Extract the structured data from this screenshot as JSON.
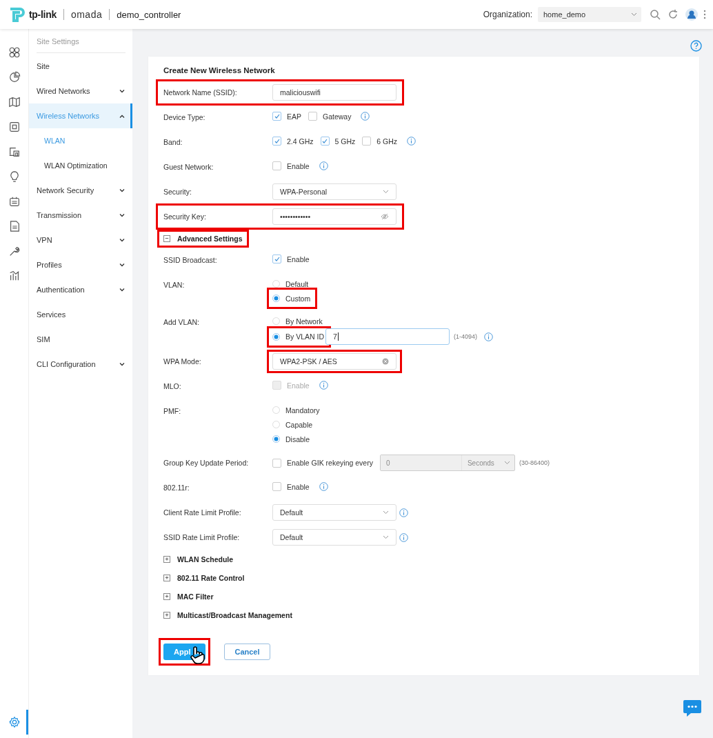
{
  "header": {
    "brand": "tp-link",
    "product": "omada",
    "controller": "demo_controller",
    "org_label": "Organization:",
    "org_value": "home_demo"
  },
  "rail": [
    {
      "selected": false
    },
    {
      "selected": false
    },
    {
      "selected": false
    },
    {
      "selected": false
    },
    {
      "selected": false
    },
    {
      "selected": false
    },
    {
      "selected": false
    },
    {
      "selected": false
    },
    {
      "selected": false
    },
    {
      "selected": false
    }
  ],
  "rail_bottom": {
    "selected": true
  },
  "sidebar": {
    "title": "Site Settings",
    "items": [
      {
        "label": "Site",
        "selected": false
      },
      {
        "label": "Wired Networks",
        "selected": false,
        "expanded": false
      },
      {
        "label": "Wireless Networks",
        "selected": true,
        "expanded": true,
        "children": [
          {
            "label": "WLAN",
            "selected": true
          },
          {
            "label": "WLAN Optimization",
            "selected": false
          }
        ]
      },
      {
        "label": "Network Security",
        "selected": false,
        "expanded": false
      },
      {
        "label": "Transmission",
        "selected": false,
        "expanded": false
      },
      {
        "label": "VPN",
        "selected": false,
        "expanded": false
      },
      {
        "label": "Profiles",
        "selected": false,
        "expanded": false
      },
      {
        "label": "Authentication",
        "selected": false,
        "expanded": false
      },
      {
        "label": "Services",
        "selected": false
      },
      {
        "label": "SIM",
        "selected": false
      },
      {
        "label": "CLI Configuration",
        "selected": false,
        "expanded": false
      }
    ]
  },
  "form": {
    "title": "Create New Wireless Network",
    "rows": [
      {
        "kind": "row",
        "label": "Network Name (SSID):",
        "highlighted": true,
        "lines": [
          [
            {
              "kind": "text",
              "value": "maliciouswifi"
            }
          ]
        ]
      },
      {
        "kind": "row",
        "label": "Device Type:",
        "lines": [
          [
            {
              "kind": "checkbox",
              "label": "EAP",
              "checked": true
            },
            {
              "kind": "checkbox",
              "label": "Gateway",
              "checked": false
            },
            {
              "kind": "info"
            }
          ]
        ]
      },
      {
        "kind": "row",
        "label": "Band:",
        "lines": [
          [
            {
              "kind": "checkbox",
              "label": "2.4 GHz",
              "checked": true
            },
            {
              "kind": "checkbox",
              "label": "5 GHz",
              "checked": true
            },
            {
              "kind": "checkbox",
              "label": "6 GHz",
              "checked": false
            },
            {
              "kind": "info"
            }
          ]
        ]
      },
      {
        "kind": "row",
        "label": "Guest Network:",
        "lines": [
          [
            {
              "kind": "checkbox",
              "label": "Enable",
              "checked": false
            },
            {
              "kind": "info"
            }
          ]
        ]
      },
      {
        "kind": "row",
        "label": "Security:",
        "lines": [
          [
            {
              "kind": "select",
              "value": "WPA-Personal"
            }
          ]
        ]
      },
      {
        "kind": "row",
        "label": "Security Key:",
        "highlighted": true,
        "lines": [
          [
            {
              "kind": "password",
              "value": "••••••••••••"
            }
          ]
        ]
      },
      {
        "kind": "section",
        "label": "Advanced Settings",
        "expanded": true,
        "highlighted": true
      },
      {
        "kind": "row",
        "label": "SSID Broadcast:",
        "lines": [
          [
            {
              "kind": "checkbox",
              "label": "Enable",
              "checked": true
            }
          ]
        ]
      },
      {
        "kind": "row",
        "label": "VLAN:",
        "lines": [
          [
            {
              "kind": "radio",
              "label": "Default",
              "selected": false
            }
          ],
          [
            {
              "kind": "radio",
              "label": "Custom",
              "selected": true,
              "highlighted": true
            }
          ]
        ]
      },
      {
        "kind": "row",
        "label": "Add VLAN:",
        "lines": [
          [
            {
              "kind": "radio",
              "label": "By Network",
              "selected": false
            }
          ],
          [
            {
              "kind": "radio",
              "label": "By VLAN ID",
              "selected": true,
              "highlighted": true
            },
            {
              "kind": "text",
              "value": "7",
              "focused": true
            },
            {
              "kind": "hint",
              "text": "(1-4094)"
            },
            {
              "kind": "info"
            }
          ]
        ]
      },
      {
        "kind": "row",
        "label": "WPA Mode:",
        "lines": [
          [
            {
              "kind": "select-clear",
              "value": "WPA2-PSK / AES",
              "highlighted": true
            }
          ]
        ]
      },
      {
        "kind": "row",
        "label": "MLO:",
        "lines": [
          [
            {
              "kind": "checkbox",
              "label": "Enable",
              "checked": false,
              "disabled": true
            },
            {
              "kind": "info"
            }
          ]
        ]
      },
      {
        "kind": "row",
        "label": "PMF:",
        "lines": [
          [
            {
              "kind": "radio",
              "label": "Mandatory",
              "selected": false
            }
          ],
          [
            {
              "kind": "radio",
              "label": "Capable",
              "selected": false
            }
          ],
          [
            {
              "kind": "radio",
              "label": "Disable",
              "selected": true
            }
          ]
        ]
      },
      {
        "kind": "row",
        "label": "Group Key Update Period:",
        "lines": [
          [
            {
              "kind": "checkbox",
              "label": "Enable GIK rekeying every",
              "checked": false
            },
            {
              "kind": "number-unit",
              "value": "0",
              "unit": "Seconds",
              "disabled": true
            },
            {
              "kind": "hint",
              "text": "(30-86400)"
            }
          ]
        ]
      },
      {
        "kind": "row",
        "label": "802.11r:",
        "lines": [
          [
            {
              "kind": "checkbox",
              "label": "Enable",
              "checked": false
            },
            {
              "kind": "info"
            }
          ]
        ]
      },
      {
        "kind": "row",
        "label": "Client Rate Limit Profile:",
        "lines": [
          [
            {
              "kind": "select",
              "value": "Default"
            },
            {
              "kind": "info"
            }
          ]
        ]
      },
      {
        "kind": "row",
        "label": "SSID Rate Limit Profile:",
        "lines": [
          [
            {
              "kind": "select",
              "value": "Default"
            },
            {
              "kind": "info"
            }
          ]
        ]
      },
      {
        "kind": "section",
        "label": "WLAN Schedule",
        "expanded": false
      },
      {
        "kind": "section",
        "label": "802.11 Rate Control",
        "expanded": false
      },
      {
        "kind": "section",
        "label": "MAC Filter",
        "expanded": false
      },
      {
        "kind": "section",
        "label": "Multicast/Broadcast Management",
        "expanded": false
      }
    ],
    "buttons": [
      {
        "kind": "primary",
        "label": "Appl",
        "highlighted": true
      },
      {
        "kind": "secondary",
        "label": "Cancel"
      }
    ]
  }
}
